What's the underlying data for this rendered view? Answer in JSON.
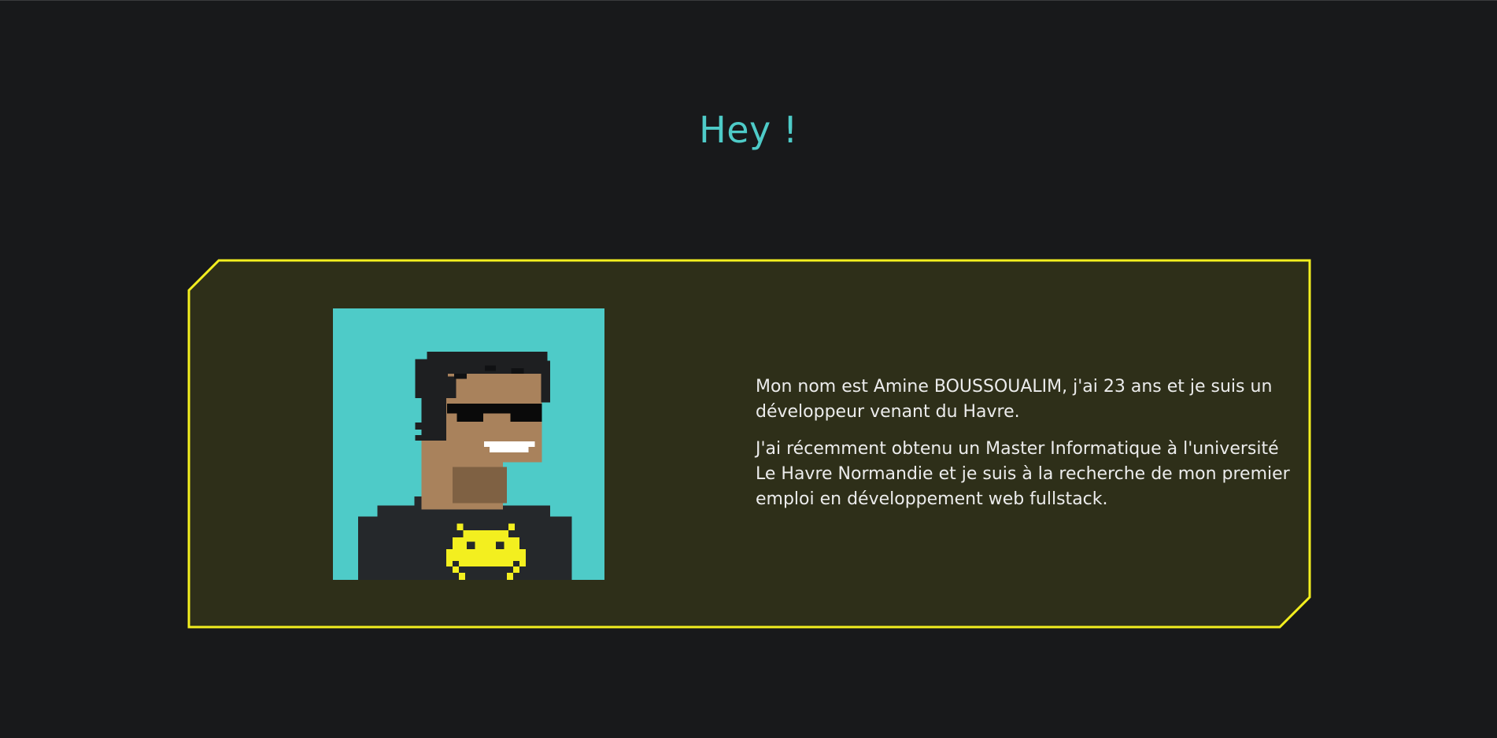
{
  "page": {
    "title": "Hey !"
  },
  "colors": {
    "background": "#18191b",
    "title": "#4ecbc8",
    "card_fill": "#2e2f19",
    "card_border": "#f3ef1f",
    "text": "#ececec",
    "avatar_bg": "#4ecbc8"
  },
  "profile": {
    "avatar_icon": "pixel-art-avatar-with-sunglasses",
    "bio_paragraphs": [
      "Mon nom est Amine BOUSSOUALIM, j'ai 23 ans et je suis un développeur venant du Havre.",
      "J'ai récemment obtenu un Master Informatique à l'université Le Havre Normandie et je suis à la recherche de mon premier emploi en développement web fullstack."
    ]
  }
}
